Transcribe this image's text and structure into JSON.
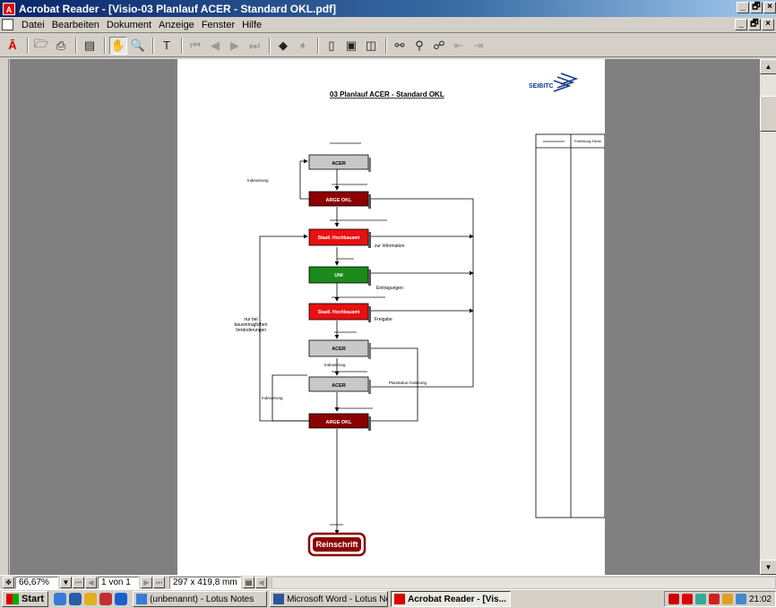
{
  "window": {
    "title": "Acrobat Reader - [Visio-03 Planlauf ACER - Standard OKL.pdf]",
    "controls": [
      "_",
      "🗗",
      "×"
    ]
  },
  "menu": {
    "items": [
      {
        "label": "Datei",
        "key": "D"
      },
      {
        "label": "Bearbeiten",
        "key": "B"
      },
      {
        "label": "Dokument",
        "key": "o"
      },
      {
        "label": "Anzeige",
        "key": "A"
      },
      {
        "label": "Fenster",
        "key": "F"
      },
      {
        "label": "Hilfe",
        "key": "H"
      }
    ]
  },
  "toolbar": {
    "icons": [
      "acrobat-icon",
      "open-icon",
      "print-icon",
      "navigation-pane-icon",
      "hand-icon",
      "zoom-icon",
      "text-select-icon",
      "first-page-icon",
      "prev-page-icon",
      "next-page-icon",
      "last-page-icon",
      "go-back-icon",
      "go-forward-icon",
      "actual-size-icon",
      "fit-page-icon",
      "fit-width-icon",
      "find-icon",
      "search-icon",
      "web-capture-icon",
      "nav-back-icon",
      "nav-forward-icon"
    ]
  },
  "document": {
    "title": "03 Planlauf ACER - Standard OKL",
    "logo_text": "SEIBITC",
    "sidebar_table_header_right": "Prüfbitung-Farbe",
    "nodes": {
      "acer1": "ACER",
      "arge1": "ARGE OKL",
      "staatl1": "Staatl. Hochbauamt",
      "uni": "UNI",
      "staatl2": "Staatl. Hochbauamt",
      "acer2": "ACER",
      "acer3": "ACER",
      "arge2": "ARGE OKL",
      "final": "Reinschrift"
    },
    "labels": {
      "einzeichnung1": "Indexeirung",
      "zur_information": "zur Information",
      "eintragungen": "Eintragungen",
      "freigabe": "Freigabe",
      "nur_bei": "nur bei",
      "bauvertraglichen": "bauvertraglichen",
      "veraenderungen": "Veränderungen",
      "einzeichnung2": "Indexeirung",
      "einzeichnung3": "Indexeirung",
      "pruefstatus": "Planstatus-Änderung"
    }
  },
  "statusbar": {
    "zoom": "66,67%",
    "page": "1 von 1",
    "size": "297 x 419,8 mm"
  },
  "taskbar": {
    "start": "Start",
    "tasks": [
      {
        "label": "(unbenannt) - Lotus Notes",
        "active": false
      },
      {
        "label": "Microsoft Word - Lotus Not...",
        "active": false
      },
      {
        "label": "Acrobat Reader - [Vis...",
        "active": true
      }
    ],
    "clock": "21:02"
  },
  "colors": {
    "dark_red": "#8b0000",
    "red": "#e81010",
    "green": "#1a8a1a",
    "gray_box": "#c8c8c8"
  }
}
